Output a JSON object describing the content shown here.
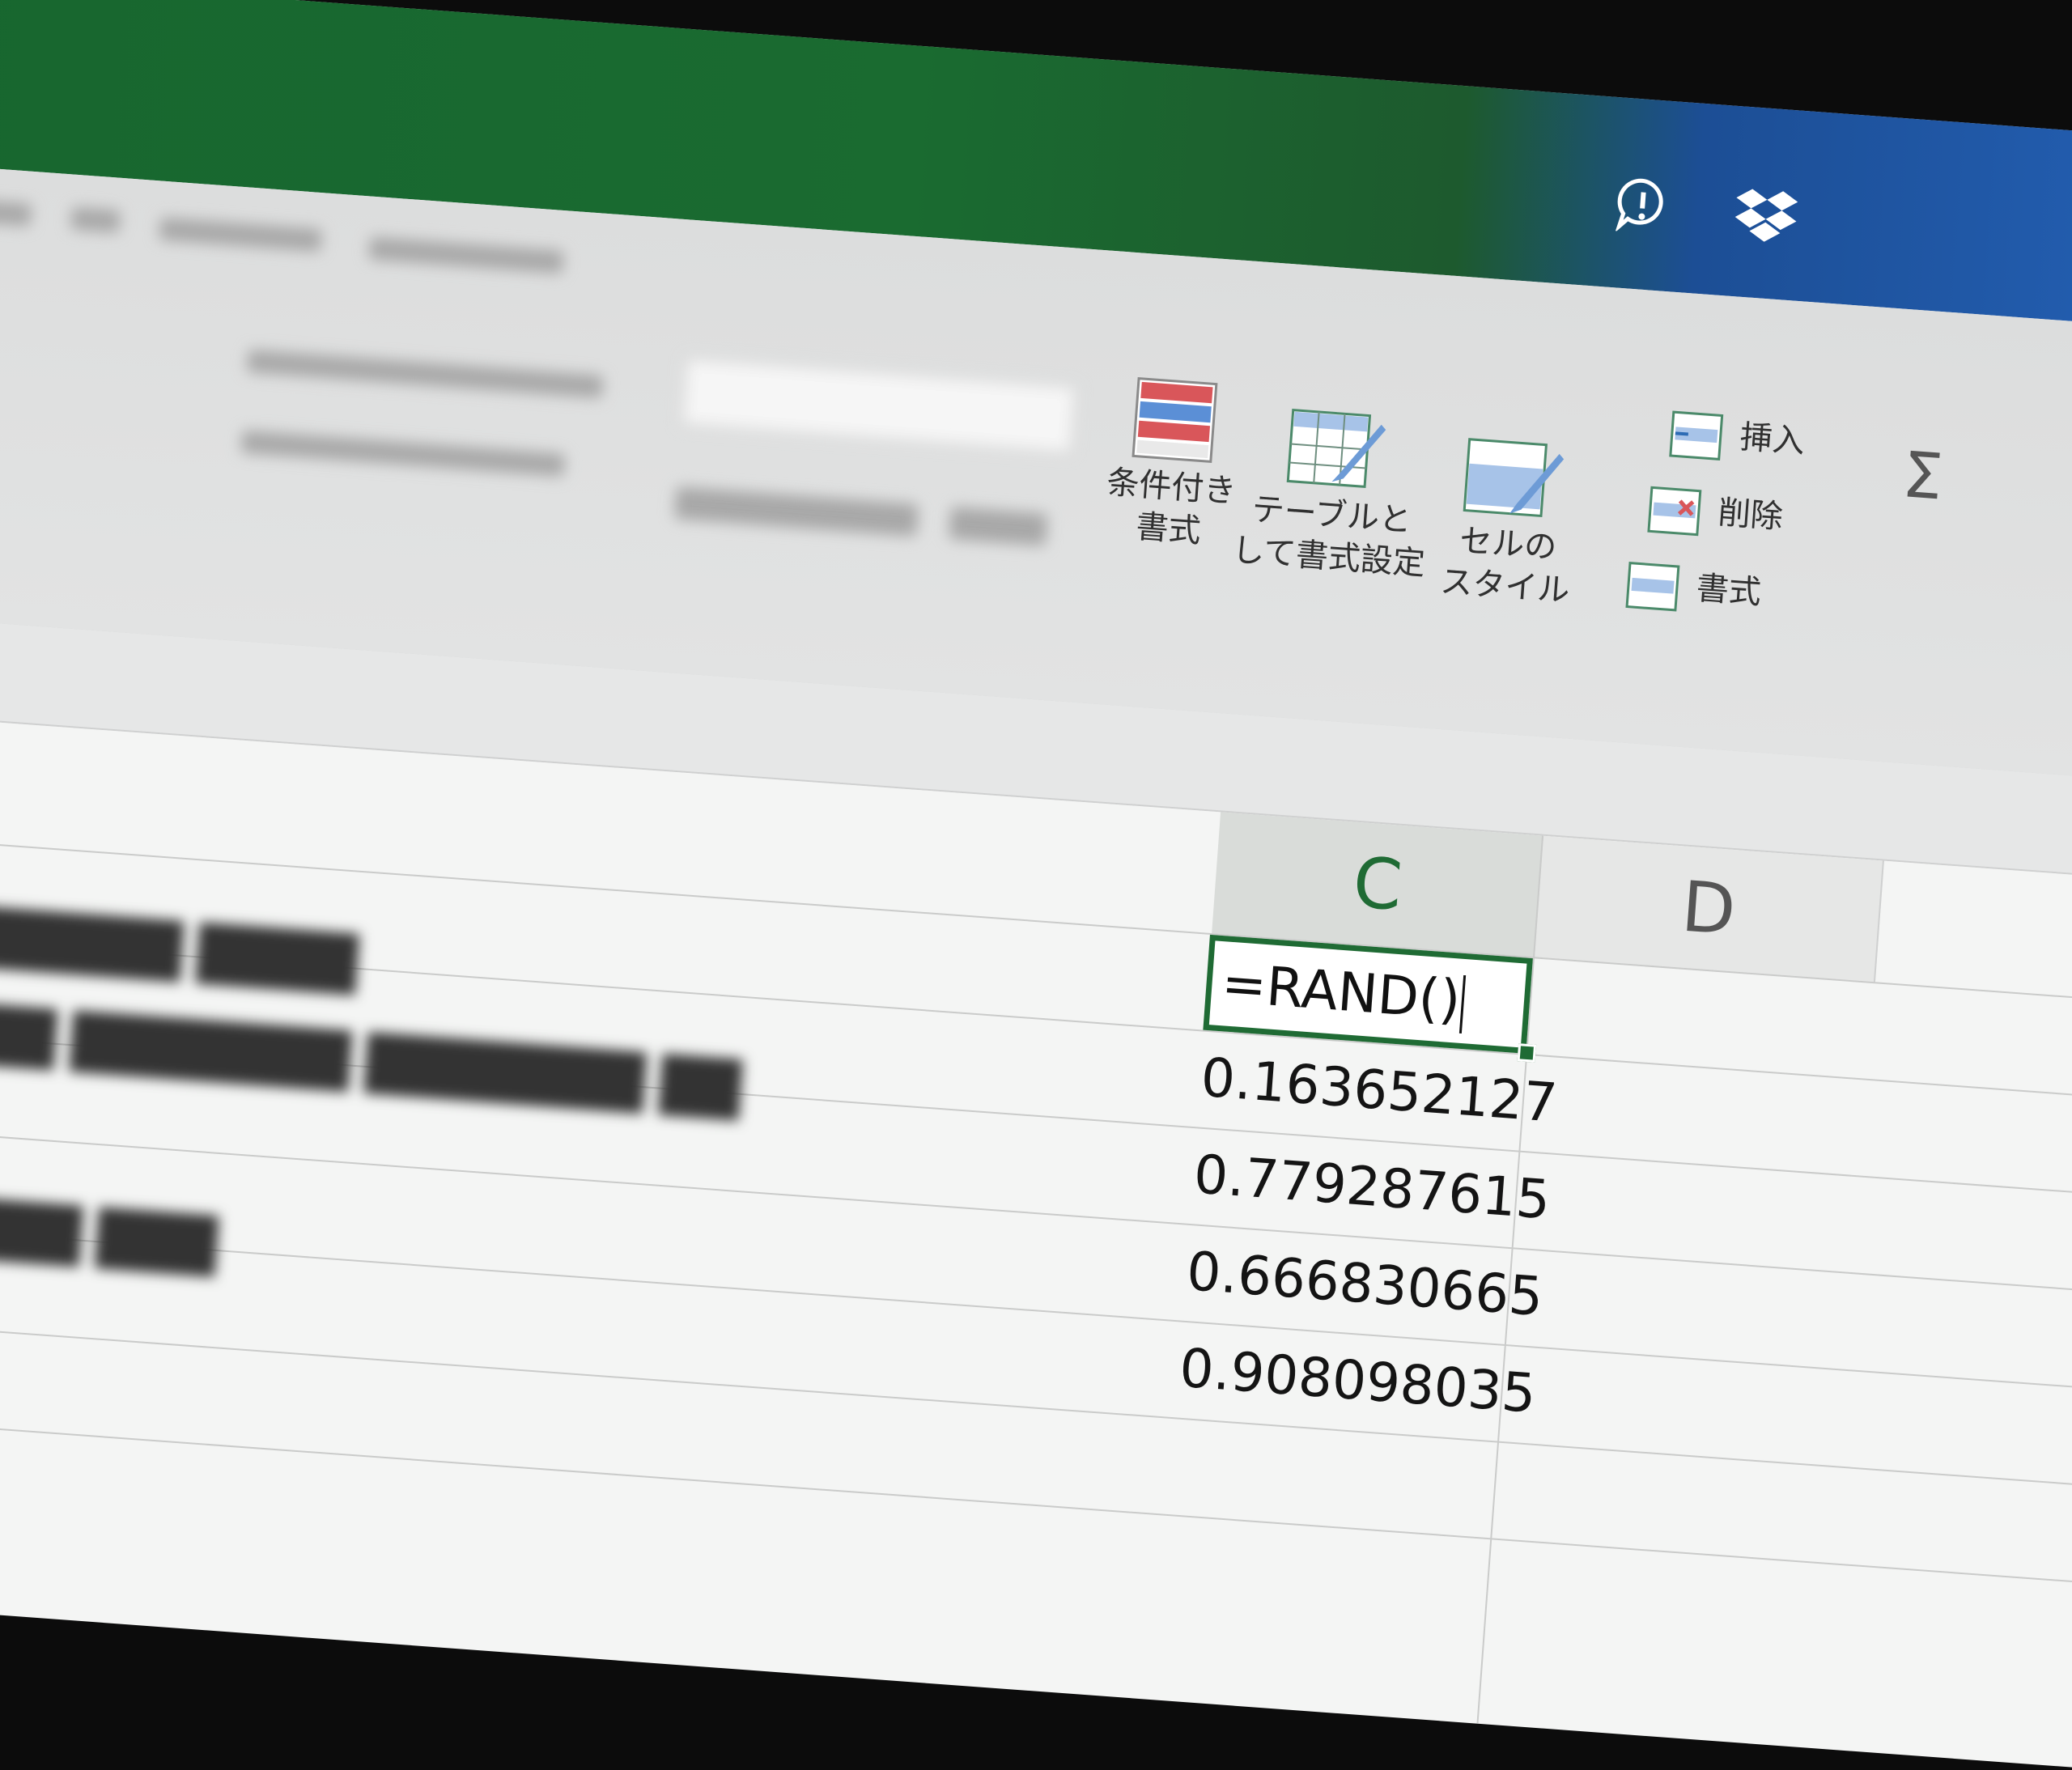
{
  "window": {
    "title": ""
  },
  "title_icons": [
    "feedback-icon",
    "dropbox-icon"
  ],
  "ribbon": {
    "styles": [
      {
        "name": "conditional-format",
        "label": "条件付き\n書式"
      },
      {
        "name": "format-as-table",
        "label": "テーブルと\nして書式設定"
      },
      {
        "name": "cell-styles",
        "label": "セルの\nスタイル"
      }
    ],
    "cells": [
      {
        "name": "insert",
        "label": "挿入"
      },
      {
        "name": "delete",
        "label": "削除"
      },
      {
        "name": "format",
        "label": "書式"
      }
    ],
    "sum_symbol": "Σ"
  },
  "columns": {
    "c": "C",
    "d": "D"
  },
  "active_cell": {
    "formula": "=RAND()"
  },
  "values": [
    "0.163652127",
    "0.779287615",
    "0.666830665",
    "0.908098035"
  ],
  "colors": {
    "excel_green": "#1f6b34",
    "titlebar_blue": "#2461b6"
  }
}
